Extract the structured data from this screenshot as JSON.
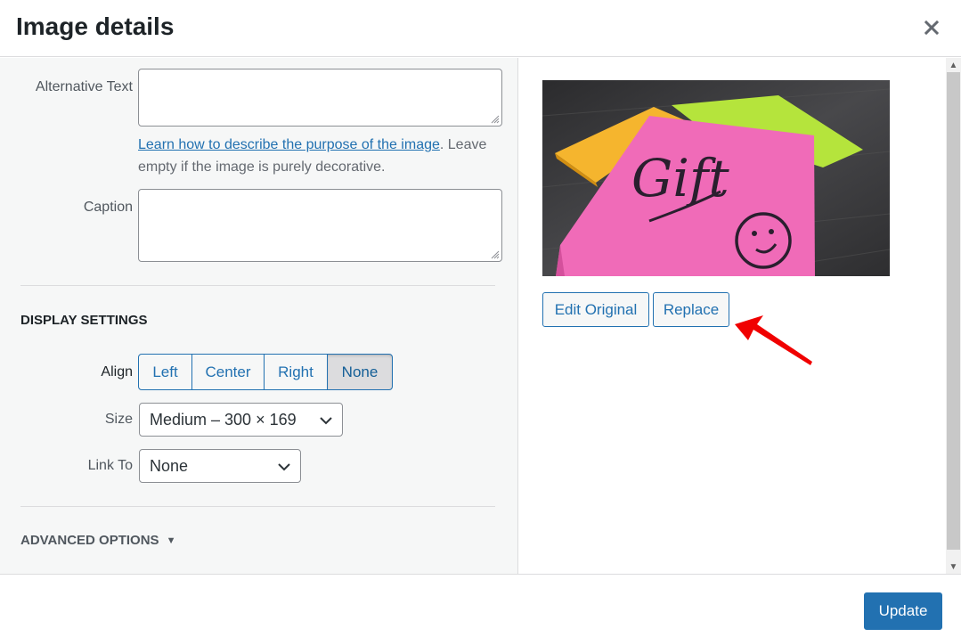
{
  "header": {
    "title": "Image details",
    "close_icon": "close-icon"
  },
  "attachment": {
    "alt_text": {
      "label": "Alternative Text",
      "value": ""
    },
    "help": {
      "link_text": "Learn how to describe the purpose of the image",
      "trailing_text": ". Leave empty if the image is purely decorative."
    },
    "caption": {
      "label": "Caption",
      "value": ""
    }
  },
  "display_settings": {
    "title": "Display Settings",
    "align": {
      "label": "Align",
      "options": [
        "Left",
        "Center",
        "Right",
        "None"
      ],
      "selected": "None"
    },
    "size": {
      "label": "Size",
      "value": "Medium – 300 × 169"
    },
    "link_to": {
      "label": "Link To",
      "value": "None"
    }
  },
  "advanced": {
    "label": "Advanced Options",
    "icon": "triangle-down-icon"
  },
  "preview": {
    "alt": "Sticky notes with 'Gift' written on pink note",
    "note_text": "Gift",
    "colors": {
      "pink": "#f06bb8",
      "yellow": "#f5b52e",
      "green": "#b5e43c",
      "table": "#3a3a3c"
    }
  },
  "actions": {
    "edit_original": "Edit Original",
    "replace": "Replace",
    "update": "Update"
  },
  "annotation": {
    "type": "red-arrow",
    "points_to": "Replace",
    "color": "#f00000"
  },
  "theme": {
    "accent": "#2271b1",
    "panel_bg": "#f6f7f7"
  }
}
